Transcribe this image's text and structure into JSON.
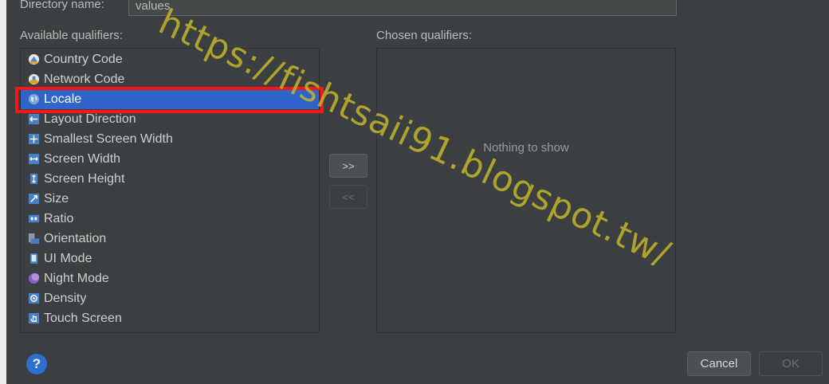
{
  "directory": {
    "label": "Directory name:",
    "value": "values"
  },
  "available": {
    "label": "Available qualifiers:",
    "items": [
      {
        "label": "Country Code",
        "icon": "country-code-icon"
      },
      {
        "label": "Network Code",
        "icon": "network-code-icon"
      },
      {
        "label": "Locale",
        "icon": "globe-icon",
        "selected": true
      },
      {
        "label": "Layout Direction",
        "icon": "layout-direction-icon"
      },
      {
        "label": "Smallest Screen Width",
        "icon": "smallest-width-icon"
      },
      {
        "label": "Screen Width",
        "icon": "screen-width-icon"
      },
      {
        "label": "Screen Height",
        "icon": "screen-height-icon"
      },
      {
        "label": "Size",
        "icon": "size-icon"
      },
      {
        "label": "Ratio",
        "icon": "ratio-icon"
      },
      {
        "label": "Orientation",
        "icon": "orientation-icon"
      },
      {
        "label": "UI Mode",
        "icon": "ui-mode-icon"
      },
      {
        "label": "Night Mode",
        "icon": "night-mode-icon"
      },
      {
        "label": "Density",
        "icon": "density-icon"
      },
      {
        "label": "Touch Screen",
        "icon": "touch-screen-icon"
      }
    ]
  },
  "chosen": {
    "label": "Chosen qualifiers:",
    "empty_text": "Nothing to show"
  },
  "buttons": {
    "add": ">>",
    "remove": "<<",
    "help": "?",
    "cancel": "Cancel",
    "ok": "OK"
  },
  "watermark": "https://fishtsaii91.blogspot.tw/",
  "colors": {
    "selection": "#2f65ca",
    "highlight_border": "#ff1414",
    "accent": "#2d6ed1",
    "watermark": "#c3b52a"
  }
}
